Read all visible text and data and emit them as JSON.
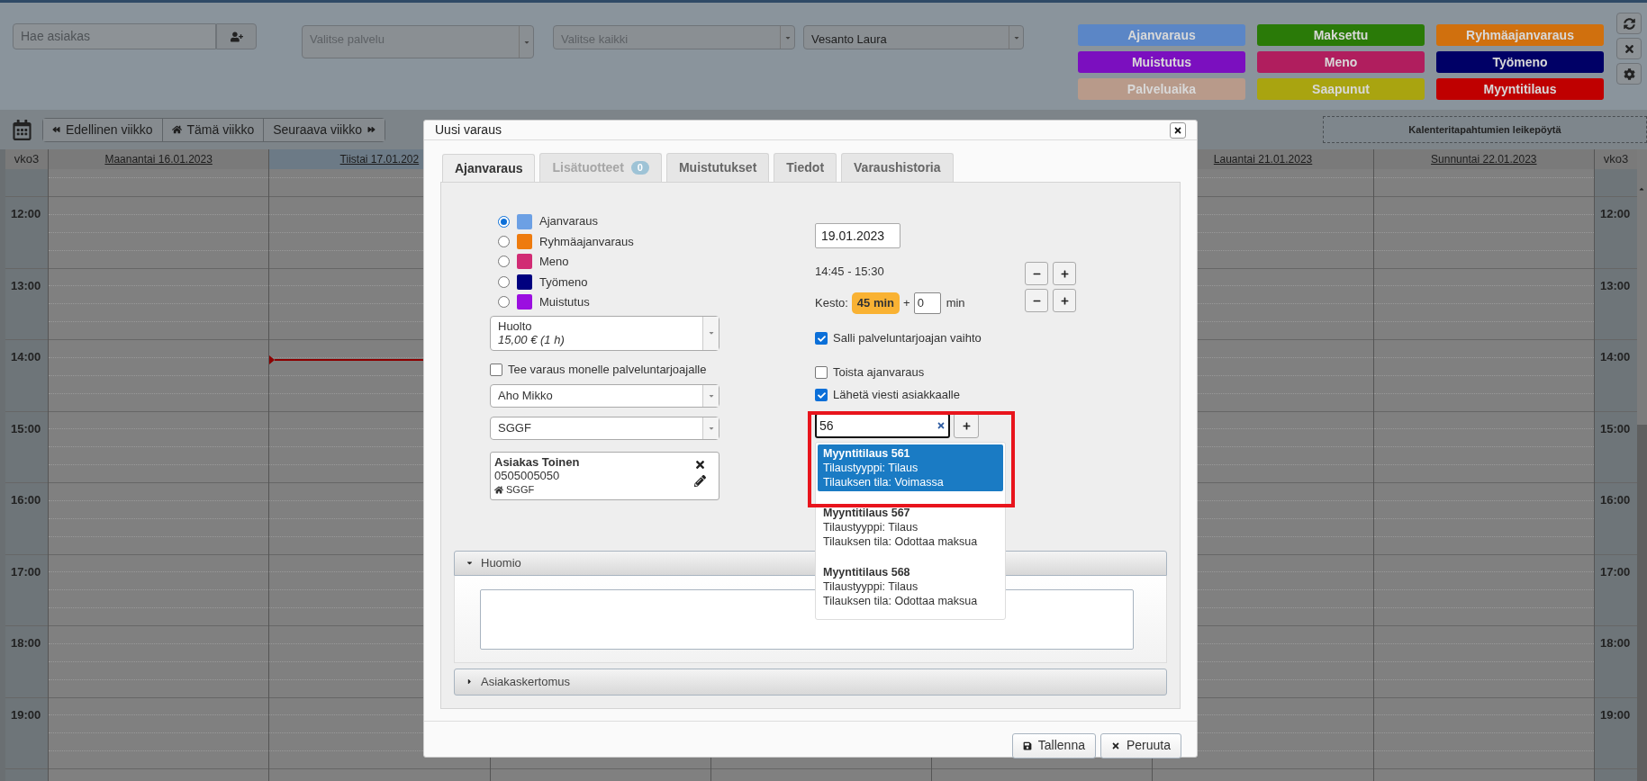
{
  "toolbar": {
    "customer_search": {
      "placeholder": "Hae asiakas"
    },
    "service_select": {
      "placeholder": "Valitse palvelu"
    },
    "all_select": {
      "placeholder": "Valitse kaikki"
    },
    "provider_select": {
      "value": "Vesanto Laura"
    }
  },
  "legend": [
    {
      "label": "Ajanvaraus",
      "color": "#5b86c6"
    },
    {
      "label": "Maksettu",
      "color": "#2a7a08"
    },
    {
      "label": "Ryhmäajanvaraus",
      "color": "#d0700e"
    },
    {
      "label": "Muistutus",
      "color": "#7b0fbf"
    },
    {
      "label": "Meno",
      "color": "#b01e5e"
    },
    {
      "label": "Työmeno",
      "color": "#000066"
    },
    {
      "label": "Palveluaika",
      "color": "#b89a8a"
    },
    {
      "label": "Saapunut",
      "color": "#a9a410"
    },
    {
      "label": "Myyntitilaus",
      "color": "#bf0000"
    }
  ],
  "week_nav": [
    {
      "label": "Edellinen viikko",
      "kind": "prev"
    },
    {
      "label": "Tämä viikko",
      "kind": "today"
    },
    {
      "label": "Seuraava viikko",
      "kind": "next"
    }
  ],
  "clipboard": "Kalenteritapahtumien leikepöytä",
  "calendar": {
    "week_left": "vko3",
    "week_right": "vko3",
    "days": [
      {
        "label": "Maanantai 16.01.2023",
        "today": false,
        "now_marker": false
      },
      {
        "label": "Tiistai 17.01.202",
        "today": true,
        "now_marker": true
      }
    ],
    "weekend": [
      {
        "label": "Lauantai 21.01.2023",
        "today": false,
        "now_marker": false
      },
      {
        "label": "Sunnuntai 22.01.2023",
        "today": false,
        "now_marker": false
      }
    ],
    "hours_left": [
      "12:00",
      "13:00",
      "14:00",
      "15:00",
      "16:00",
      "17:00",
      "18:00",
      "19:00"
    ],
    "hours_right": [
      "12:00",
      "13:00",
      "14:00",
      "15:00",
      "16:00",
      "17:00",
      "18:00",
      "19:00"
    ]
  },
  "dialog": {
    "title": "Uusi varaus",
    "tabs": [
      {
        "label": "Ajanvaraus",
        "selected": true,
        "disabled": false
      },
      {
        "label": "Lisätuotteet",
        "badge": "0",
        "selected": false,
        "disabled": true
      },
      {
        "label": "Muistutukset",
        "selected": false,
        "disabled": false
      },
      {
        "label": "Tiedot",
        "selected": false,
        "disabled": false
      },
      {
        "label": "Varaushistoria",
        "selected": false,
        "disabled": false
      }
    ],
    "event_types": [
      {
        "label": "Ajanvaraus",
        "color": "#6ca0e4",
        "selected": true
      },
      {
        "label": "Ryhmäajanvaraus",
        "color": "#ee7b0e",
        "selected": false
      },
      {
        "label": "Meno",
        "color": "#d12c74",
        "selected": false
      },
      {
        "label": "Työmeno",
        "color": "#00007f",
        "selected": false
      },
      {
        "label": "Muistutus",
        "color": "#9b0fe0",
        "selected": false
      }
    ],
    "service_select": {
      "value": "Huolto",
      "detail": "15,00 € (1 h)"
    },
    "multi_provider": {
      "label": "Tee varaus monelle palveluntarjoajalle",
      "checked": false
    },
    "provider_select": {
      "value": "Aho Mikko"
    },
    "location_select": {
      "value": "SGGF"
    },
    "customer": {
      "name": "Asiakas Toinen",
      "phone": "0505005050",
      "location": "SGGF"
    },
    "date": {
      "value": "19.01.2023"
    },
    "time_range": "14:45 - 15:30",
    "duration": {
      "label": "Kesto:",
      "value": "45 min",
      "plus": "+",
      "extra": "0",
      "unit": "min"
    },
    "checkboxes": [
      {
        "label": "Salli palveluntarjoajan vaihto",
        "checked": true
      },
      {
        "label": "Toista ajanvaraus",
        "checked": false
      },
      {
        "label": "Lähetä viesti asiakkaalle",
        "checked": true
      }
    ],
    "order_search": {
      "value": "56"
    },
    "order_results": [
      {
        "title": "Myyntitilaus 561",
        "type": "Tilaustyyppi: Tilaus",
        "status": "Tilauksen tila: Voimassa",
        "selected": true
      },
      {
        "title": "Myyntitilaus 567",
        "type": "Tilaustyyppi: Tilaus",
        "status": "Tilauksen tila: Odottaa maksua",
        "selected": false
      },
      {
        "title": "Myyntitilaus 568",
        "type": "Tilaustyyppi: Tilaus",
        "status": "Tilauksen tila: Odottaa maksua",
        "selected": false
      }
    ],
    "sections": [
      {
        "label": "Huomio",
        "expanded": true
      },
      {
        "label": "Asiakaskertomus",
        "expanded": false
      }
    ],
    "buttons": [
      {
        "label": "Tallenna",
        "kind": "save"
      },
      {
        "label": "Peruuta",
        "kind": "cancel"
      }
    ]
  }
}
